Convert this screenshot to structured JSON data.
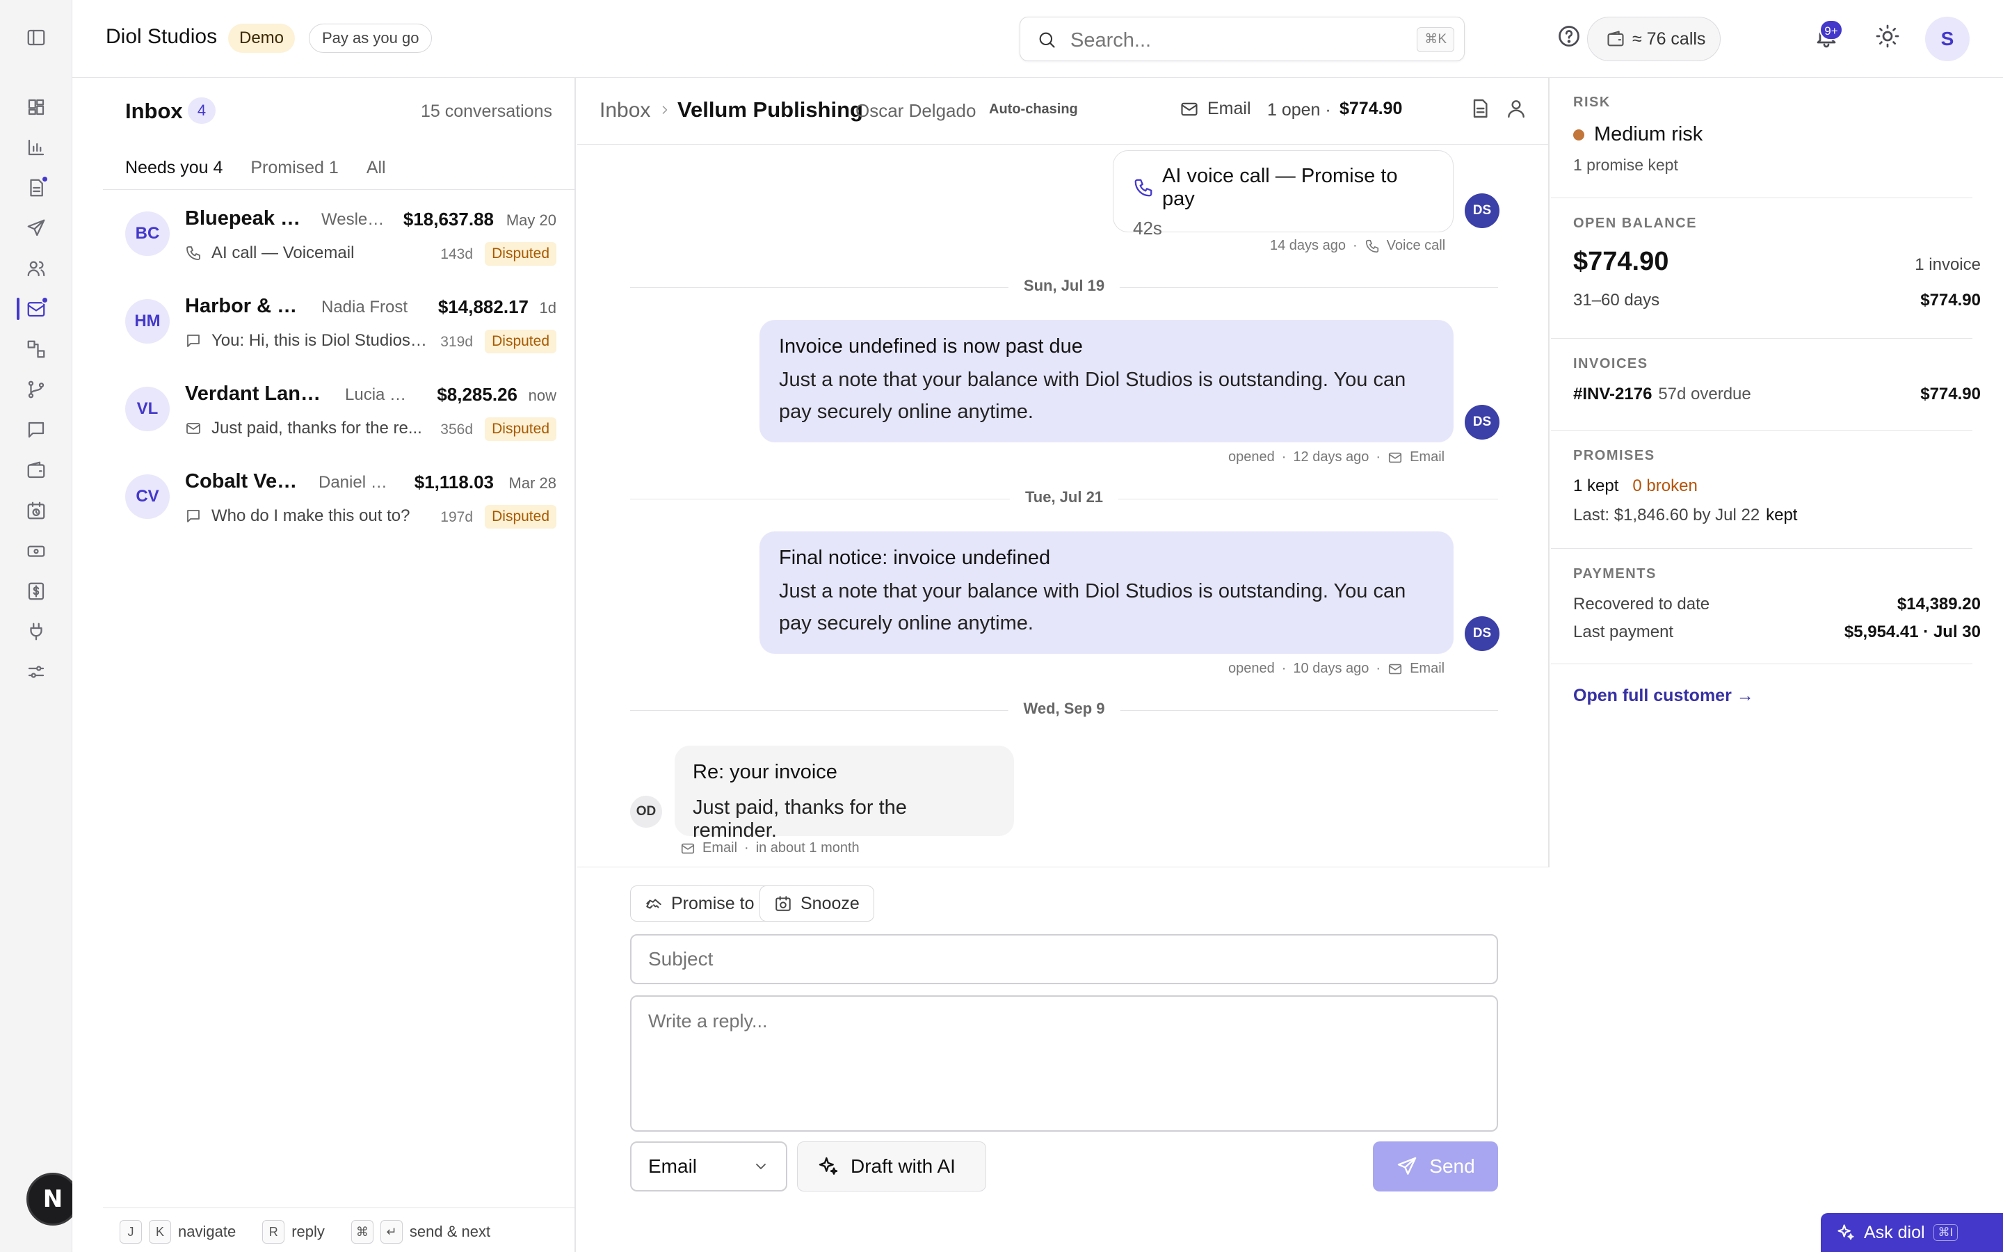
{
  "app": {
    "brand": "Diol Studios",
    "tag_demo": "Demo",
    "tag_plan": "Pay as you go",
    "search_placeholder": "Search...",
    "search_shortcut": "⌘K",
    "calls": "≈ 76 calls",
    "notif_badge": "9+",
    "user_initial": "S"
  },
  "rail": {
    "icons": [
      "sidebar-toggle-icon",
      "dashboard-icon",
      "chart-icon",
      "document-icon",
      "send-icon",
      "users-icon",
      "inbox-icon",
      "workflow-icon",
      "branch-icon",
      "chat-icon",
      "wallet-icon",
      "calendar-icon",
      "card-icon",
      "dollar-icon",
      "plug-icon",
      "settings-icon"
    ],
    "logo_letter": "N"
  },
  "inbox": {
    "title": "Inbox",
    "count": "4",
    "conversations": "15 conversations",
    "filters": [
      "Needs you 4",
      "Promised 1",
      "All"
    ],
    "rows": [
      {
        "initials": "BC",
        "name": "Bluepeak C...",
        "contact": "Wesley...",
        "amount": "$18,637.88",
        "date": "May 20",
        "icon": "phone-icon",
        "snippet": "AI call — Voicemail",
        "age": "143d",
        "status": "Disputed"
      },
      {
        "initials": "HM",
        "name": "Harbor & Main",
        "contact": "Nadia Frost",
        "amount": "$14,882.17",
        "date": "1d",
        "icon": "chat-icon",
        "snippet": "You: Hi, this is Diol Studios ...",
        "age": "319d",
        "status": "Disputed"
      },
      {
        "initials": "VL",
        "name": "Verdant Lands...",
        "contact": "Lucia M...",
        "amount": "$8,285.26",
        "date": "now",
        "icon": "mail-icon",
        "snippet": "Just paid, thanks for the re...",
        "age": "356d",
        "status": "Disputed"
      },
      {
        "initials": "CV",
        "name": "Cobalt Vent...",
        "contact": "Daniel R...",
        "amount": "$1,118.03",
        "date": "Mar 28",
        "icon": "chat-icon",
        "snippet": "Who do I make this out to?",
        "age": "197d",
        "status": "Disputed"
      }
    ],
    "shortcuts": {
      "j": "J",
      "k": "K",
      "navigate": "navigate",
      "r": "R",
      "reply": "reply",
      "cmd": "⌘",
      "enter": "↵",
      "send_next": "send & next"
    }
  },
  "conversation": {
    "breadcrumb_root": "Inbox",
    "customer": "Vellum Publishing",
    "contact": "Oscar Delgado",
    "mode": "Auto-chasing",
    "channel": "Email",
    "open": "1 open",
    "dot": "·",
    "amount": "$774.90",
    "call": {
      "title": "AI voice call — Promise to pay",
      "duration": "42s",
      "meta_time": "14 days ago",
      "meta_channel": "Voice call"
    },
    "dividers": [
      "Sun, Jul 19",
      "Tue, Jul 21",
      "Wed, Sep 9"
    ],
    "msg1": {
      "title": "Invoice undefined is now past due",
      "body": "Just a note that your balance with Diol Studios is outstanding. You can pay securely online anytime.",
      "status": "opened",
      "time": "12 days ago",
      "channel": "Email"
    },
    "msg2": {
      "title": "Final notice: invoice undefined",
      "body": "Just a note that your balance with Diol Studios is outstanding. You can pay securely online anytime.",
      "status": "opened",
      "time": "10 days ago",
      "channel": "Email"
    },
    "reply_in": {
      "title": "Re: your invoice",
      "body": "Just paid, thanks for the reminder.",
      "channel": "Email",
      "time": "in about 1 month",
      "initials": "OD"
    },
    "sender_initials": "DS"
  },
  "composer": {
    "promise_label": "Promise to pay",
    "snooze_label": "Snooze",
    "subject_placeholder": "Subject",
    "reply_placeholder": "Write a reply...",
    "channel_value": "Email",
    "draft_label": "Draft with AI",
    "send_label": "Send"
  },
  "side": {
    "risk_label": "RISK",
    "risk_value": "Medium risk",
    "risk_color": "#c2763a",
    "risk_sub": "1 promise kept",
    "balance_label": "OPEN BALANCE",
    "balance_value": "$774.90",
    "balance_invoices": "1 invoice",
    "aging_label": "31–60 days",
    "aging_value": "$774.90",
    "invoices_label": "INVOICES",
    "invoice_id": "#INV-2176",
    "invoice_overdue": "57d overdue",
    "invoice_amount": "$774.90",
    "promises_label": "PROMISES",
    "kept": "1 kept",
    "broken": "0 broken",
    "last_promise": "Last: $1,846.60 by Jul 22",
    "last_promise_status": "kept",
    "payments_label": "PAYMENTS",
    "recovered_label": "Recovered to date",
    "recovered_value": "$14,389.20",
    "last_payment_label": "Last payment",
    "last_payment_value": "$5,954.41 · Jul 30",
    "open_customer": "Open full customer →"
  },
  "ask": {
    "label": "Ask diol",
    "shortcut": "⌘I"
  },
  "colors": {
    "accent": "#4338ca",
    "disputed_bg": "#fdf1d6",
    "disputed_fg": "#a65a00"
  }
}
